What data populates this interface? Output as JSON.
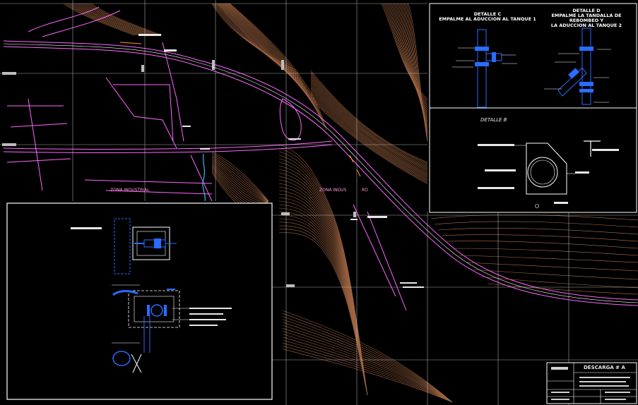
{
  "drawing": {
    "details": {
      "detalle_c": {
        "line1": "DETALLE C",
        "line2": "EMPALME AL ADUCCION AL TANQUE 1"
      },
      "detalle_d": {
        "line1": "DETALLE D",
        "line2": "EMPALME LA TANDALLA DE REBOMBEO Y",
        "line3": "LA ADUCCION AL TANQUE 2"
      },
      "detalle_b": {
        "title": "DETALLE B"
      }
    },
    "map_labels": {
      "zona_industrial": "ZONA INDUSTRIAL",
      "zona_label_2": "ZONA INDUS",
      "ro_label": "RO"
    },
    "title_block": {
      "sheet_name": "DESCARGA # A"
    },
    "colors": {
      "background": "#000000",
      "contour": "#b0704a",
      "road": "#ff66ff",
      "grid": "#cfcfcf",
      "pipe": "#2a6cff",
      "cyan": "#39b6e8",
      "frame": "#ffffff"
    }
  }
}
